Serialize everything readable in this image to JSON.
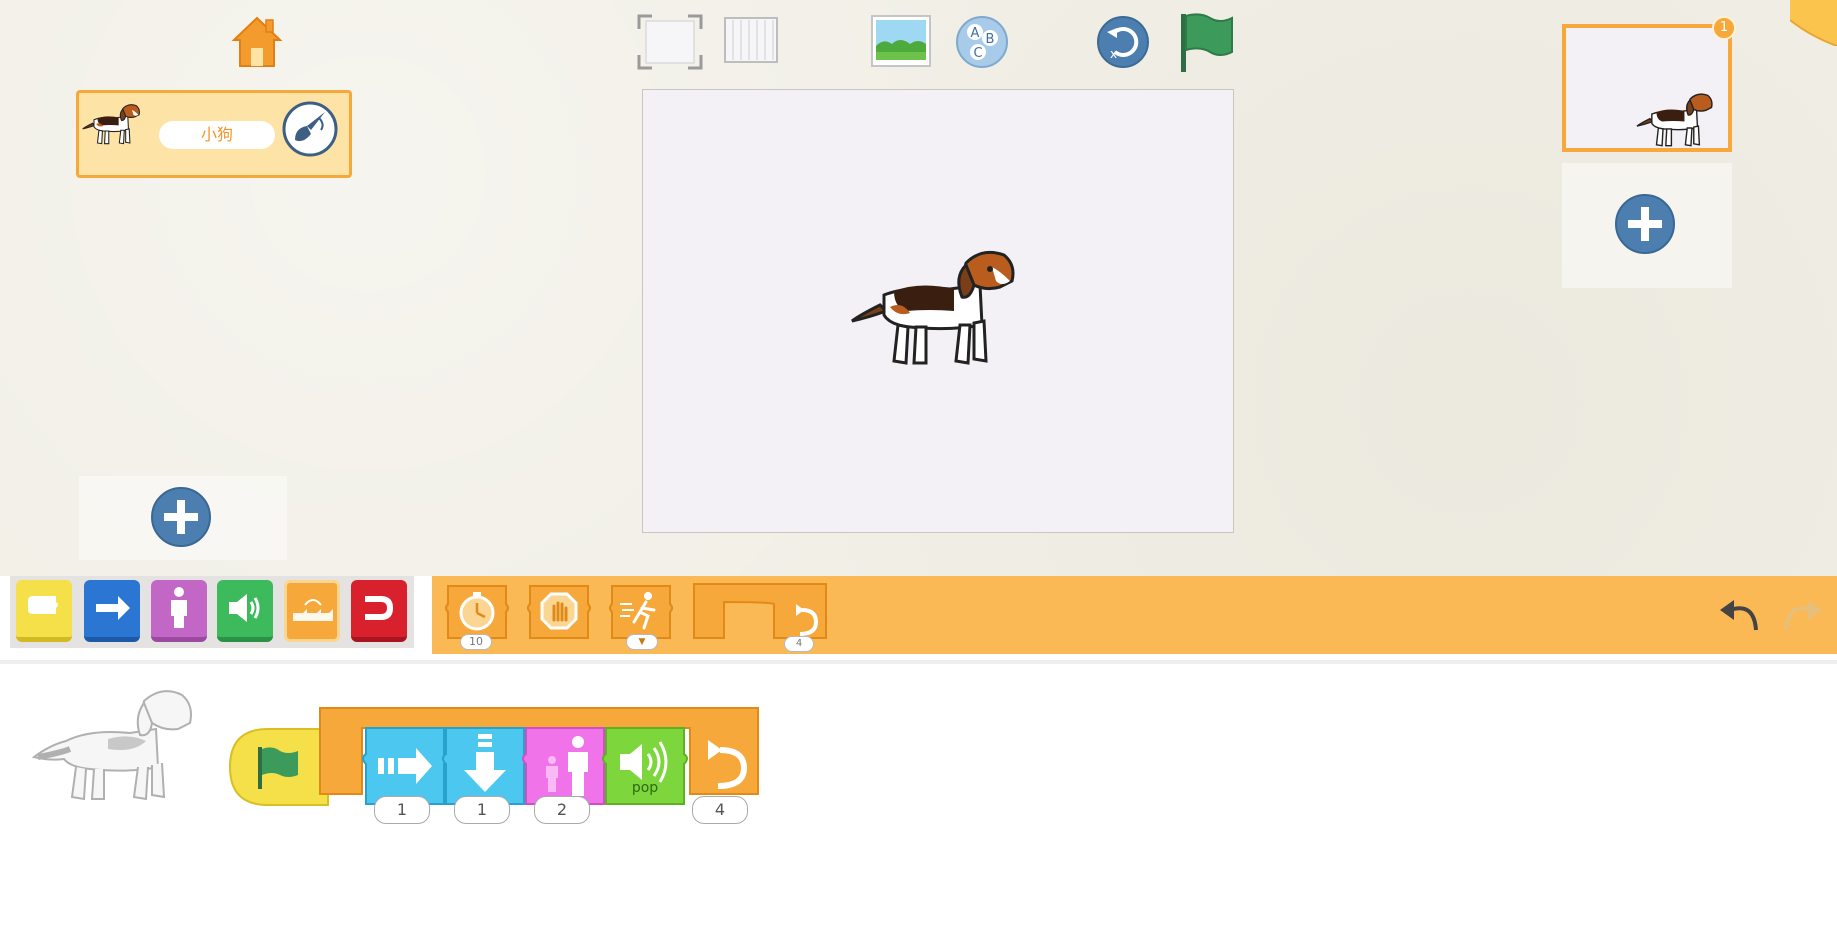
{
  "toolbar": {
    "home_icon": "home-icon",
    "fullscreen_icon": "fullscreen-icon",
    "grid_icon": "grid-icon",
    "background_icon": "background-icon",
    "text_icon": "abc-text-icon",
    "reset_icon": "reset-icon",
    "green_flag_icon": "green-flag-icon"
  },
  "sprites": {
    "items": [
      {
        "name": "小狗"
      }
    ],
    "add_icon": "plus-icon"
  },
  "pages": {
    "count_badge": "1",
    "add_icon": "plus-icon"
  },
  "categories": [
    {
      "name": "triggering",
      "color": "#f6e04a"
    },
    {
      "name": "motion",
      "color": "#2a76d2"
    },
    {
      "name": "looks",
      "color": "#c267c6"
    },
    {
      "name": "sound",
      "color": "#3dbb5c"
    },
    {
      "name": "control",
      "color": "#f6a83a"
    },
    {
      "name": "end",
      "color": "#d8212d"
    }
  ],
  "palette": {
    "blocks": [
      {
        "name": "wait-block",
        "value": "10"
      },
      {
        "name": "stop-block",
        "value": ""
      },
      {
        "name": "set-speed-block",
        "value": "▼"
      },
      {
        "name": "repeat-block",
        "value": "4"
      }
    ]
  },
  "script": {
    "blocks": [
      {
        "name": "start-on-green-flag-block",
        "value": ""
      },
      {
        "name": "move-right-block",
        "value": "1"
      },
      {
        "name": "move-down-block",
        "value": "1"
      },
      {
        "name": "grow-block",
        "value": "2"
      },
      {
        "name": "play-sound-block",
        "label": "pop",
        "value": ""
      },
      {
        "name": "repeat-block",
        "value": "4"
      }
    ]
  },
  "colors": {
    "accent_orange": "#f6a83a",
    "palette_bg": "#fbb955",
    "button_blue": "#4c7fb0"
  }
}
